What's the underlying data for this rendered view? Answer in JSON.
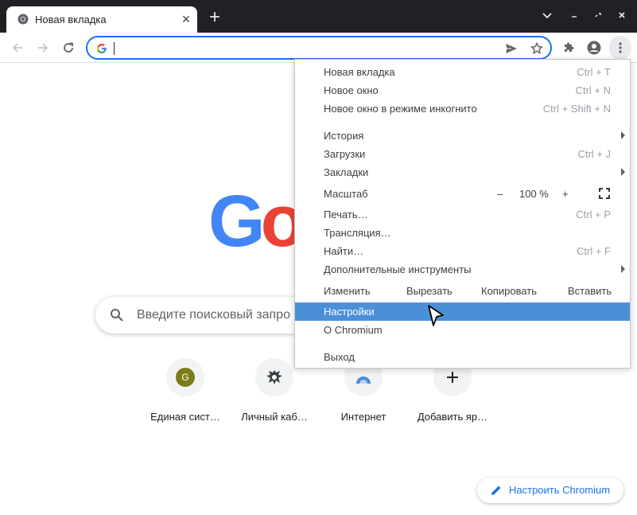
{
  "tab": {
    "title": "Новая вкладка"
  },
  "search": {
    "placeholder": "Введите поисковый запро"
  },
  "shortcuts": [
    {
      "title": "Единая сист…",
      "initial": "G"
    },
    {
      "title": "Личный каб…"
    },
    {
      "title": "Интернет"
    },
    {
      "title": "Добавить яр…"
    }
  ],
  "customize": {
    "label": "Настроить Chromium"
  },
  "menu": {
    "new_tab": {
      "label": "Новая вкладка",
      "shortcut": "Ctrl + T"
    },
    "new_window": {
      "label": "Новое окно",
      "shortcut": "Ctrl + N"
    },
    "incognito": {
      "label": "Новое окно в режиме инкогнито",
      "shortcut": "Ctrl + Shift + N"
    },
    "history": {
      "label": "История"
    },
    "downloads": {
      "label": "Загрузки",
      "shortcut": "Ctrl + J"
    },
    "bookmarks": {
      "label": "Закладки"
    },
    "zoom": {
      "label": "Масштаб",
      "minus": "–",
      "value": "100 %",
      "plus": "+"
    },
    "print": {
      "label": "Печать…",
      "shortcut": "Ctrl + P"
    },
    "cast": {
      "label": "Трансляция…"
    },
    "find": {
      "label": "Найти…",
      "shortcut": "Ctrl + F"
    },
    "more_tools": {
      "label": "Дополнительные инструменты"
    },
    "edit": {
      "label": "Изменить",
      "cut": "Вырезать",
      "copy": "Копировать",
      "paste": "Вставить"
    },
    "settings": {
      "label": "Настройки"
    },
    "about": {
      "label": "О Chromium"
    },
    "exit": {
      "label": "Выход"
    }
  },
  "colors": {
    "accent": "#1a73e8",
    "highlight": "#4a90d9",
    "frame": "#202124"
  }
}
